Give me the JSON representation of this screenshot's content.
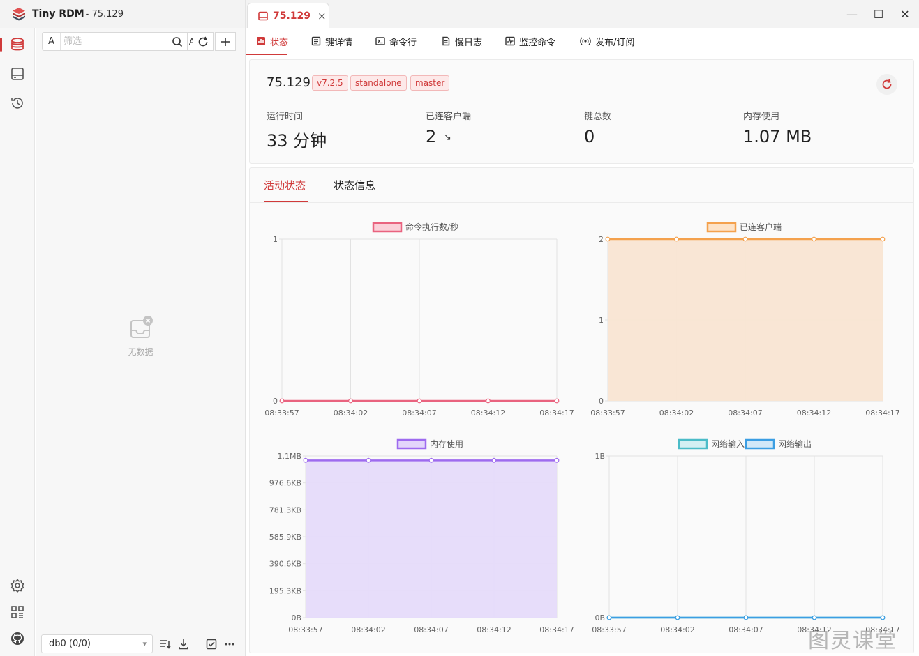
{
  "window": {
    "app_name": "Tiny RDM",
    "app_sub": "- 75.129",
    "minimize": "—",
    "maximize": "☐",
    "close": "✕"
  },
  "tab": {
    "label": "75.129",
    "close": "×"
  },
  "rail": [
    "database-icon",
    "server-icon",
    "history-icon",
    "settings-icon",
    "apps-icon",
    "github-icon"
  ],
  "panel": {
    "filter_prefix": "A",
    "filter_placeholder": "筛选",
    "filter_case": "A",
    "empty_text": "无数据",
    "db_select": "db0 (0/0)"
  },
  "subtabs": [
    {
      "label": "状态",
      "icon": "status-icon"
    },
    {
      "label": "键详情",
      "icon": "key-detail-icon"
    },
    {
      "label": "命令行",
      "icon": "terminal-icon"
    },
    {
      "label": "慢日志",
      "icon": "slow-log-icon"
    },
    {
      "label": "监控命令",
      "icon": "monitor-icon"
    },
    {
      "label": "发布/订阅",
      "icon": "pubsub-icon"
    }
  ],
  "server": {
    "name": "75.129",
    "badges": [
      "v7.2.5",
      "standalone",
      "master"
    ]
  },
  "stats": [
    {
      "label": "运行时间",
      "value": "33 分钟"
    },
    {
      "label": "已连客户端",
      "value": "2"
    },
    {
      "label": "键总数",
      "value": "0"
    },
    {
      "label": "内存使用",
      "value": "1.07 MB"
    }
  ],
  "clients_trend": "↘",
  "chart_tabs": [
    "活动状态",
    "状态信息"
  ],
  "colors": {
    "accent": "#d03a3a",
    "pink": "#e9637f",
    "orange": "#f4a14d",
    "purple": "#9e6bef",
    "teal": "#4bbcc8",
    "blue": "#3b9ee3"
  },
  "chart_data": [
    {
      "type": "line",
      "legend": [
        "命令执行数/秒"
      ],
      "x": [
        "08:33:57",
        "08:34:02",
        "08:34:07",
        "08:34:12",
        "08:34:17"
      ],
      "y_ticks": [
        "0",
        "1"
      ],
      "ylim": [
        0,
        1
      ],
      "series": [
        {
          "name": "命令执行数/秒",
          "values": [
            0,
            0,
            0,
            0,
            0
          ]
        }
      ]
    },
    {
      "type": "area",
      "legend": [
        "已连客户端"
      ],
      "x": [
        "08:33:57",
        "08:34:02",
        "08:34:07",
        "08:34:12",
        "08:34:17"
      ],
      "y_ticks": [
        "0",
        "1",
        "2"
      ],
      "ylim": [
        0,
        2
      ],
      "series": [
        {
          "name": "已连客户端",
          "values": [
            2,
            2,
            2,
            2,
            2
          ]
        }
      ]
    },
    {
      "type": "area",
      "legend": [
        "内存使用"
      ],
      "x": [
        "08:33:57",
        "08:34:02",
        "08:34:07",
        "08:34:12",
        "08:34:17"
      ],
      "y_ticks": [
        "0B",
        "195.3KB",
        "390.6KB",
        "585.9KB",
        "781.3KB",
        "976.6KB",
        "1.1MB"
      ],
      "ylim": [
        0,
        1.1
      ],
      "series": [
        {
          "name": "内存使用",
          "values": [
            1.07,
            1.07,
            1.07,
            1.07,
            1.07
          ]
        }
      ]
    },
    {
      "type": "line",
      "legend": [
        "网络输入",
        "网络输出"
      ],
      "x": [
        "08:33:57",
        "08:34:02",
        "08:34:07",
        "08:34:12",
        "08:34:17"
      ],
      "y_ticks": [
        "0B",
        "1B"
      ],
      "ylim": [
        0,
        1
      ],
      "series": [
        {
          "name": "网络输入",
          "values": [
            0,
            0,
            0,
            0,
            0
          ]
        },
        {
          "name": "网络输出",
          "values": [
            0,
            0,
            0,
            0,
            0
          ]
        }
      ]
    }
  ],
  "watermark": "图灵课堂"
}
